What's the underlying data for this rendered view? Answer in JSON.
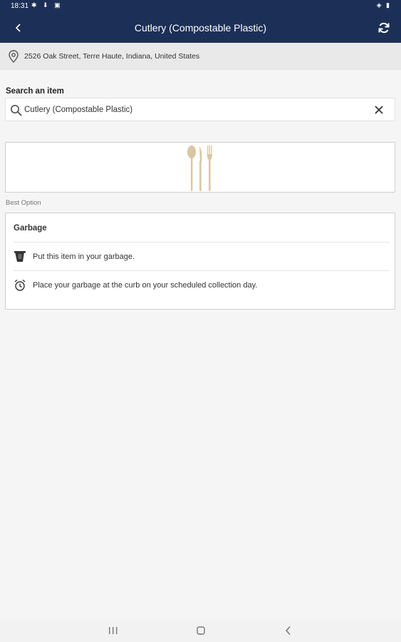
{
  "status_bar": {
    "time": "18:31",
    "left_icons": "✱ ⬇ ▣",
    "right_icons": "◈ ▮"
  },
  "app_bar": {
    "title": "Cutlery (Compostable Plastic)",
    "back_icon": "chevron-left-icon",
    "refresh_icon": "refresh-icon"
  },
  "address": {
    "text": "2526 Oak Street, Terre Haute, Indiana, United States",
    "icon": "location-pin-icon"
  },
  "search": {
    "label": "Search an item",
    "value": "Cutlery (Compostable Plastic)",
    "icon": "search-icon",
    "clear_icon": "close-icon"
  },
  "item_image": {
    "icon": "cutlery-image"
  },
  "best_option": {
    "label": "Best Option",
    "title": "Garbage",
    "rows": [
      {
        "icon": "garbage-bin-icon",
        "text": "Put this item in your garbage."
      },
      {
        "icon": "alarm-clock-icon",
        "text": "Place your garbage at the curb on your scheduled collection day."
      }
    ]
  },
  "colors": {
    "app_bar": "#1c2f57",
    "background": "#f5f5f5",
    "cutlery": "#d9c7a3"
  }
}
